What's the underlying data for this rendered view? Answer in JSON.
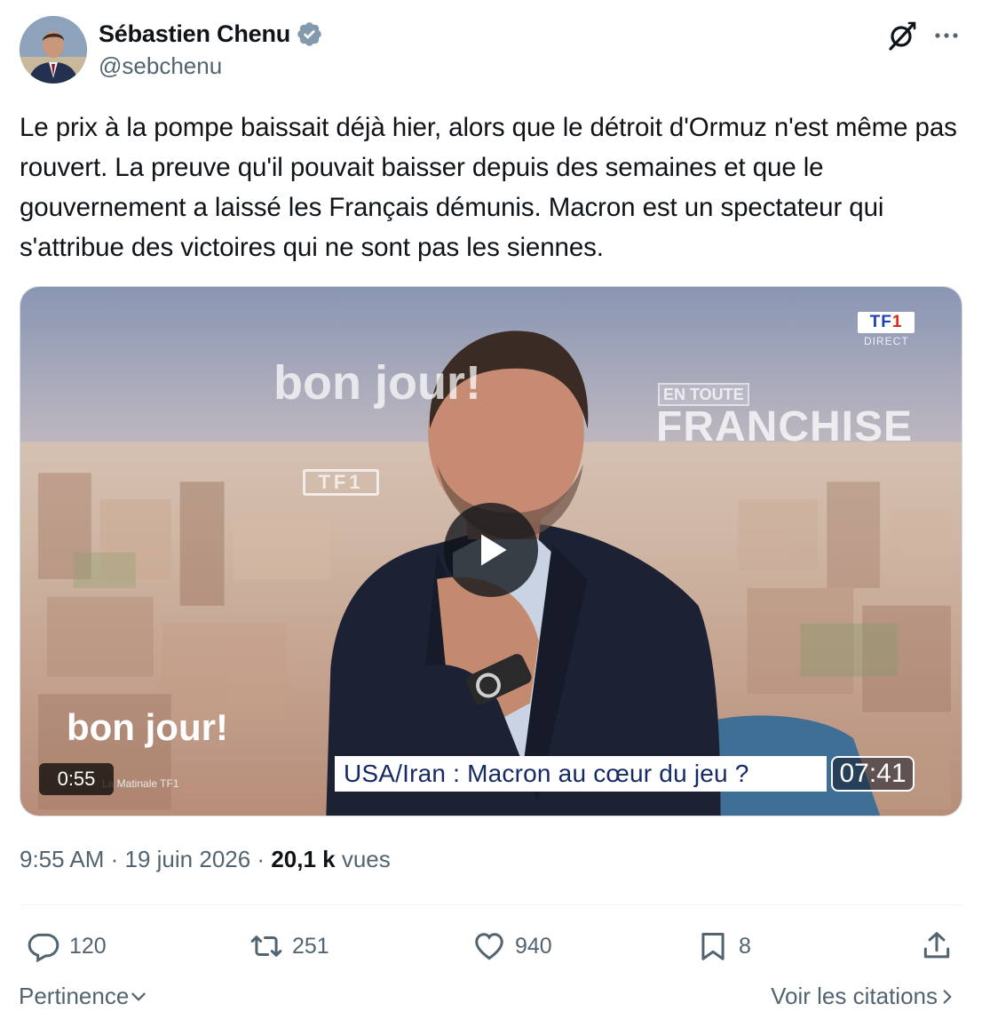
{
  "author": {
    "display_name": "Sébastien Chenu",
    "handle": "@sebchenu",
    "verified": true,
    "verified_color": "#829aab"
  },
  "tweet": {
    "text": "Le prix à la pompe baissait déjà hier, alors que le détroit d'Ormuz n'est même pas rouvert. La preuve qu'il pouvait baisser depuis des semaines et que le gouvernement a laissé les Français démunis. Macron est un spectateur qui s'attribue des victoires qui ne sont pas les siennes."
  },
  "media": {
    "type": "video",
    "duration": "0:55",
    "overlay": {
      "channel_logo": "TF1",
      "channel_status": "DIRECT",
      "show_name": "bon jour!",
      "show_badge": "TF1",
      "segment_label": "EN TOUTE",
      "segment_title": "FRANCHISE",
      "corner_title": "bon jour!",
      "corner_subtitle": "La Matinale TF1",
      "ticker": "USA/Iran : Macron au cœur du jeu ?",
      "clock": "07:41"
    }
  },
  "meta": {
    "time": "9:55 AM",
    "separator": "·",
    "date": "19 juin 2026",
    "views_count": "20,1 k",
    "views_label": "vues"
  },
  "actions": {
    "replies": "120",
    "reposts": "251",
    "likes": "940",
    "bookmarks": "8"
  },
  "footer": {
    "sort_label": "Pertinence",
    "quotes_link": "Voir les citations"
  },
  "colors": {
    "text_primary": "#0f1419",
    "text_secondary": "#536471",
    "divider": "#eff3f4"
  },
  "icons": {
    "verified": "verified-badge-icon",
    "grok": "grok-icon",
    "more": "more-icon",
    "reply": "reply-icon",
    "repost": "repost-icon",
    "like": "heart-icon",
    "bookmark": "bookmark-icon",
    "share": "share-icon",
    "play": "play-icon",
    "chevron_down": "chevron-down-icon",
    "chevron_right": "chevron-right-icon"
  }
}
